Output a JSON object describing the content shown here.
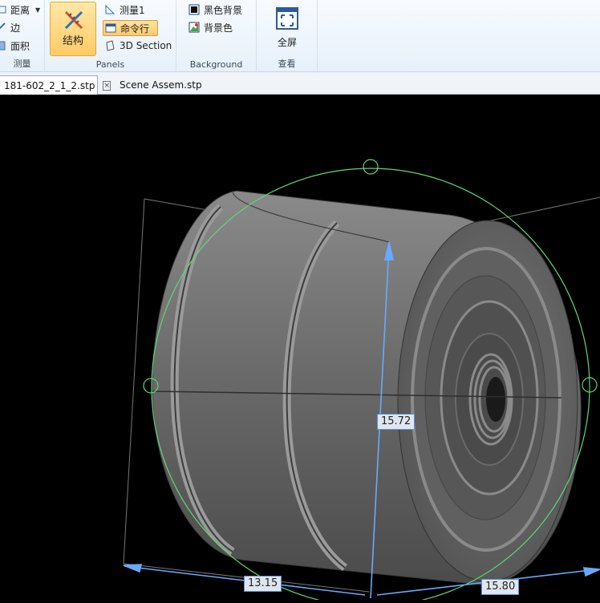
{
  "ribbon": {
    "measure_group": {
      "label": "测量",
      "items": [
        {
          "label": "距离",
          "icon": "distance-icon",
          "has_dropdown": true
        },
        {
          "label": "边",
          "icon": "edge-icon"
        },
        {
          "label": "面积",
          "icon": "area-icon"
        }
      ]
    },
    "panels_group": {
      "label": "Panels",
      "structure_button": {
        "label": "结构",
        "icon": "dna-structure-icon"
      },
      "items": [
        {
          "label": "测量1",
          "icon": "ruler-triangle-icon"
        },
        {
          "label": "命令行",
          "icon": "command-window-icon"
        },
        {
          "label": "3D Section",
          "icon": "section-icon"
        }
      ]
    },
    "background_group": {
      "label": "Background",
      "items": [
        {
          "label": "黑色背景",
          "icon": "black-background-icon"
        },
        {
          "label": "背景色",
          "icon": "background-color-icon"
        }
      ]
    },
    "view_group": {
      "label": "查看",
      "fullscreen_button": {
        "label": "全屏",
        "icon": "fullscreen-icon"
      }
    }
  },
  "tabs": [
    {
      "label": "181-602_2_1_2.stp",
      "active": true,
      "closable": true
    },
    {
      "label": "Scene Assem.stp",
      "active": false,
      "closable": false
    }
  ],
  "viewport": {
    "background": "#000000",
    "dimensions": {
      "height": "15.72",
      "width": "13.15",
      "depth": "15.80"
    }
  }
}
